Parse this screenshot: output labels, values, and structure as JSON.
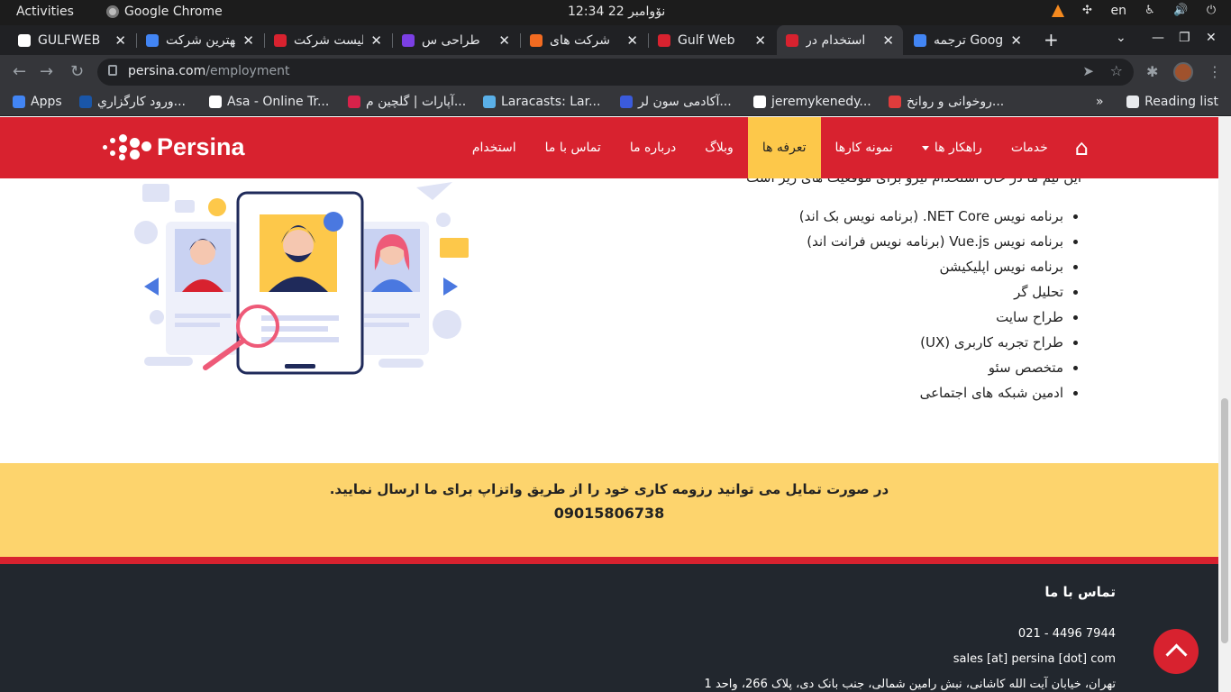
{
  "system_bar": {
    "activities": "Activities",
    "app_name": "Google Chrome",
    "clock": "نۆوامبر 22  12:34",
    "lang": "en"
  },
  "tabs": [
    {
      "title": "GULFWEB",
      "favicon_color": "#ffffff",
      "active": false
    },
    {
      "title": "بهترین شرکت",
      "favicon_color": "#4285f4",
      "active": false
    },
    {
      "title": "لیست شرکت",
      "favicon_color": "#d8222f",
      "active": false
    },
    {
      "title": "طراحی س",
      "favicon_color": "#7b3fe4",
      "active": false
    },
    {
      "title": "شرکت های",
      "favicon_color": "#f26b21",
      "active": false
    },
    {
      "title": "Gulf Web",
      "favicon_color": "#d8222f",
      "active": false
    },
    {
      "title": "استخدام در",
      "favicon_color": "#d8222f",
      "active": true
    },
    {
      "title": "ترجمه Google",
      "favicon_color": "#4285f4",
      "active": false
    }
  ],
  "address": {
    "host": "persina.com",
    "path": "/employment"
  },
  "bookmarks": [
    {
      "label": "Apps",
      "color": "#4285f4"
    },
    {
      "label": "ورود کارگزاري...",
      "color": "#1a56a8"
    },
    {
      "label": "Asa - Online Tr...",
      "color": "#ffffff"
    },
    {
      "label": "آپارات | گلچین م...",
      "color": "#d8224a"
    },
    {
      "label": "Laracasts: Lar...",
      "color": "#5ab0e8"
    },
    {
      "label": "آکادمی سون لر...",
      "color": "#3b5bdb"
    },
    {
      "label": "jeremykenedy...",
      "color": "#ffffff"
    },
    {
      "label": "روخوانی و روانخ...",
      "color": "#e03c3c"
    },
    {
      "label": "Reading list",
      "color": "#e8eaed"
    }
  ],
  "site": {
    "brand": "Persina",
    "menu": [
      {
        "label": "خدمات",
        "active": false,
        "dropdown": false
      },
      {
        "label": "راهکار ها",
        "active": false,
        "dropdown": true
      },
      {
        "label": "نمونه کارها",
        "active": false,
        "dropdown": false
      },
      {
        "label": "تعرفه ها",
        "active": true,
        "dropdown": false
      },
      {
        "label": "وبلاگ",
        "active": false,
        "dropdown": false
      },
      {
        "label": "درباره ما",
        "active": false,
        "dropdown": false
      },
      {
        "label": "تماس با ما",
        "active": false,
        "dropdown": false
      },
      {
        "label": "استخدام",
        "active": false,
        "dropdown": false
      }
    ],
    "roles": [
      "برنامه نویس NET Core. (برنامه نویس بک اند)",
      "برنامه نویس Vue.js (برنامه نویس فرانت اند)",
      "برنامه نویس اپلیکیشن",
      "تحلیل گر",
      "طراح سایت",
      "طراح تجربه کاربری (UX)",
      "متخصص سئو",
      "ادمین شبکه های اجتماعی"
    ],
    "cta": {
      "line1": "در صورت تمایل می توانید رزومه کاری خود را از طریق واتزاپ برای ما ارسال نمایید.",
      "phone": "09015806738"
    },
    "footer": {
      "heading": "تماس با ما",
      "phone": "021 - 4496 7944",
      "email": "sales [at] persina [dot] com",
      "address": "تهران، خیابان آیت الله کاشانی، نبش رامین شمالی، جنب بانک دی، پلاک 266، واحد 1"
    }
  },
  "colors": {
    "brand_red": "#d8222f",
    "accent_yellow": "#fdc84a",
    "cta_yellow": "#fdd46d",
    "footer_bg": "#22272e"
  }
}
